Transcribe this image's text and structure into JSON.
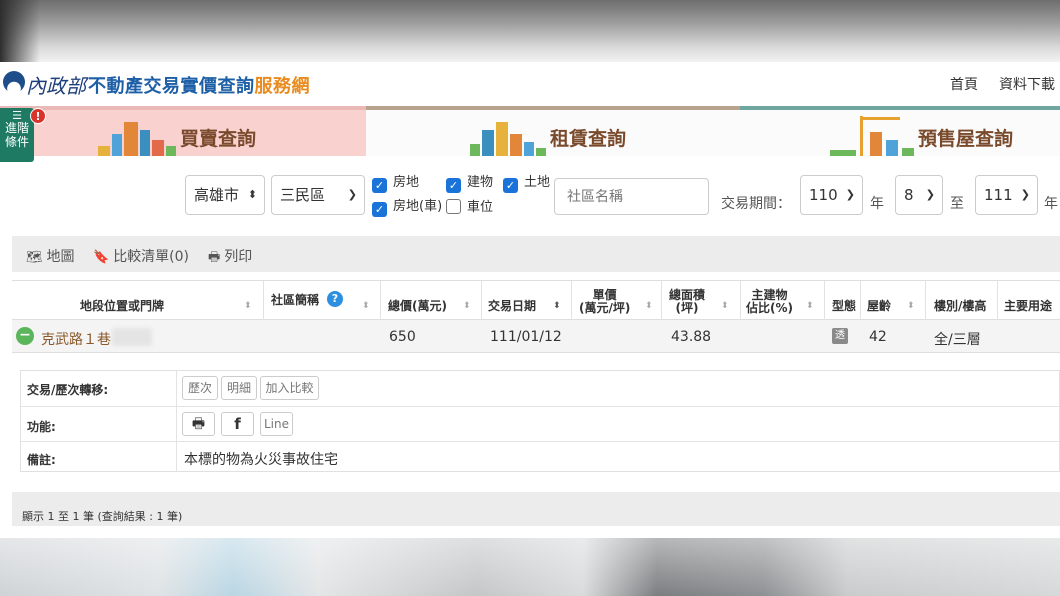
{
  "header": {
    "logo_mark": "內政部",
    "title_main": "不動產交易實價查詢",
    "title_accent": "服務網",
    "nav": [
      "首頁",
      "資料下載"
    ]
  },
  "advanced": {
    "label_line1": "進階",
    "label_line2": "條件",
    "badge": "!"
  },
  "tabs": [
    {
      "label": "買賣查詢",
      "active": true
    },
    {
      "label": "租賃查詢",
      "active": false
    },
    {
      "label": "預售屋查詢",
      "active": false
    }
  ],
  "filters": {
    "city": "高雄市",
    "district": "三民區",
    "checkboxes": [
      {
        "label": "房地",
        "checked": true
      },
      {
        "label": "建物",
        "checked": true
      },
      {
        "label": "土地",
        "checked": true
      },
      {
        "label": "房地(車)",
        "checked": true
      },
      {
        "label": "車位",
        "checked": false
      }
    ],
    "community_placeholder": "社區名稱",
    "period_label": "交易期間：",
    "from_year": "110",
    "year_unit": "年",
    "from_month": "8",
    "to_label": "至",
    "to_year": "111",
    "to_year_unit": "年"
  },
  "toolbar": {
    "map": "地圖",
    "compare": "比較清單(0)",
    "print": "列印"
  },
  "table": {
    "headers": [
      "地段位置或門牌",
      "社區簡稱",
      "總價(萬元)",
      "交易日期",
      "單價\n(萬元/坪)",
      "總面積\n(坪)",
      "主建物\n佔比(%)",
      "型態",
      "屋齡",
      "樓別/樓高",
      "主要用途"
    ],
    "row": {
      "address": "克武路１巷",
      "community": "",
      "total_price": "650",
      "date": "111/01/12",
      "unit_price": "",
      "area": "43.88",
      "main_ratio": "",
      "type_icon": "透",
      "age": "42",
      "floor": "全/三層",
      "usage": ""
    }
  },
  "detail": {
    "history_label": "交易/歷次轉移:",
    "history_buttons": [
      "歷次",
      "明細",
      "加入比較"
    ],
    "function_label": "功能:",
    "share_buttons": [
      "print-icon",
      "facebook-icon",
      "Line"
    ],
    "share_line": "Line",
    "note_label": "備註:",
    "note": "本標的物為火災事故住宅"
  },
  "footer": {
    "summary": "顯示 1 至 1 筆 (查詢結果 : 1 筆)"
  }
}
